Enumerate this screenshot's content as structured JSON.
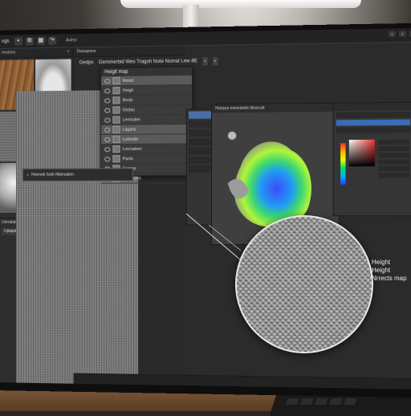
{
  "app": {
    "title": "ugs",
    "menu_label": "Aviesi",
    "tab_label": "Dweapove"
  },
  "library": {
    "header": "eestoey",
    "selected_label": "Utrnidabeled zooe",
    "field_value": "Uplapin wo dhwbed vikkeil arricota"
  },
  "node_editor": {
    "tab_label": "Gedps",
    "breadcrumb": "Gemmerbid Wes Tragsh Note Nomal Lew 8E"
  },
  "layers": {
    "header": "Heigit map",
    "items": [
      {
        "label": "Renet",
        "selected": true
      },
      {
        "label": "Heigtt",
        "selected": false
      },
      {
        "label": "Beols",
        "selected": false
      },
      {
        "label": "Gedas",
        "selected": false
      },
      {
        "label": "Levnsden",
        "selected": false
      },
      {
        "label": "Lagans",
        "selected": true
      },
      {
        "label": "Lusbade",
        "selected": true
      },
      {
        "label": "Lovnadem",
        "selected": false
      },
      {
        "label": "Paola",
        "selected": false
      },
      {
        "label": "Gargas",
        "selected": false
      },
      {
        "label": "Coxpades",
        "selected": false
      }
    ],
    "footer_action": "Honnek hoth Nbenaiten"
  },
  "viewport": {
    "header": "Harqea mennbekt dinacutt"
  },
  "callout": {
    "lines": [
      "Height",
      "Height",
      "Nrrects map"
    ]
  },
  "colors": {
    "accent": "#4a6fa5",
    "panel": "#2e2e2e"
  }
}
